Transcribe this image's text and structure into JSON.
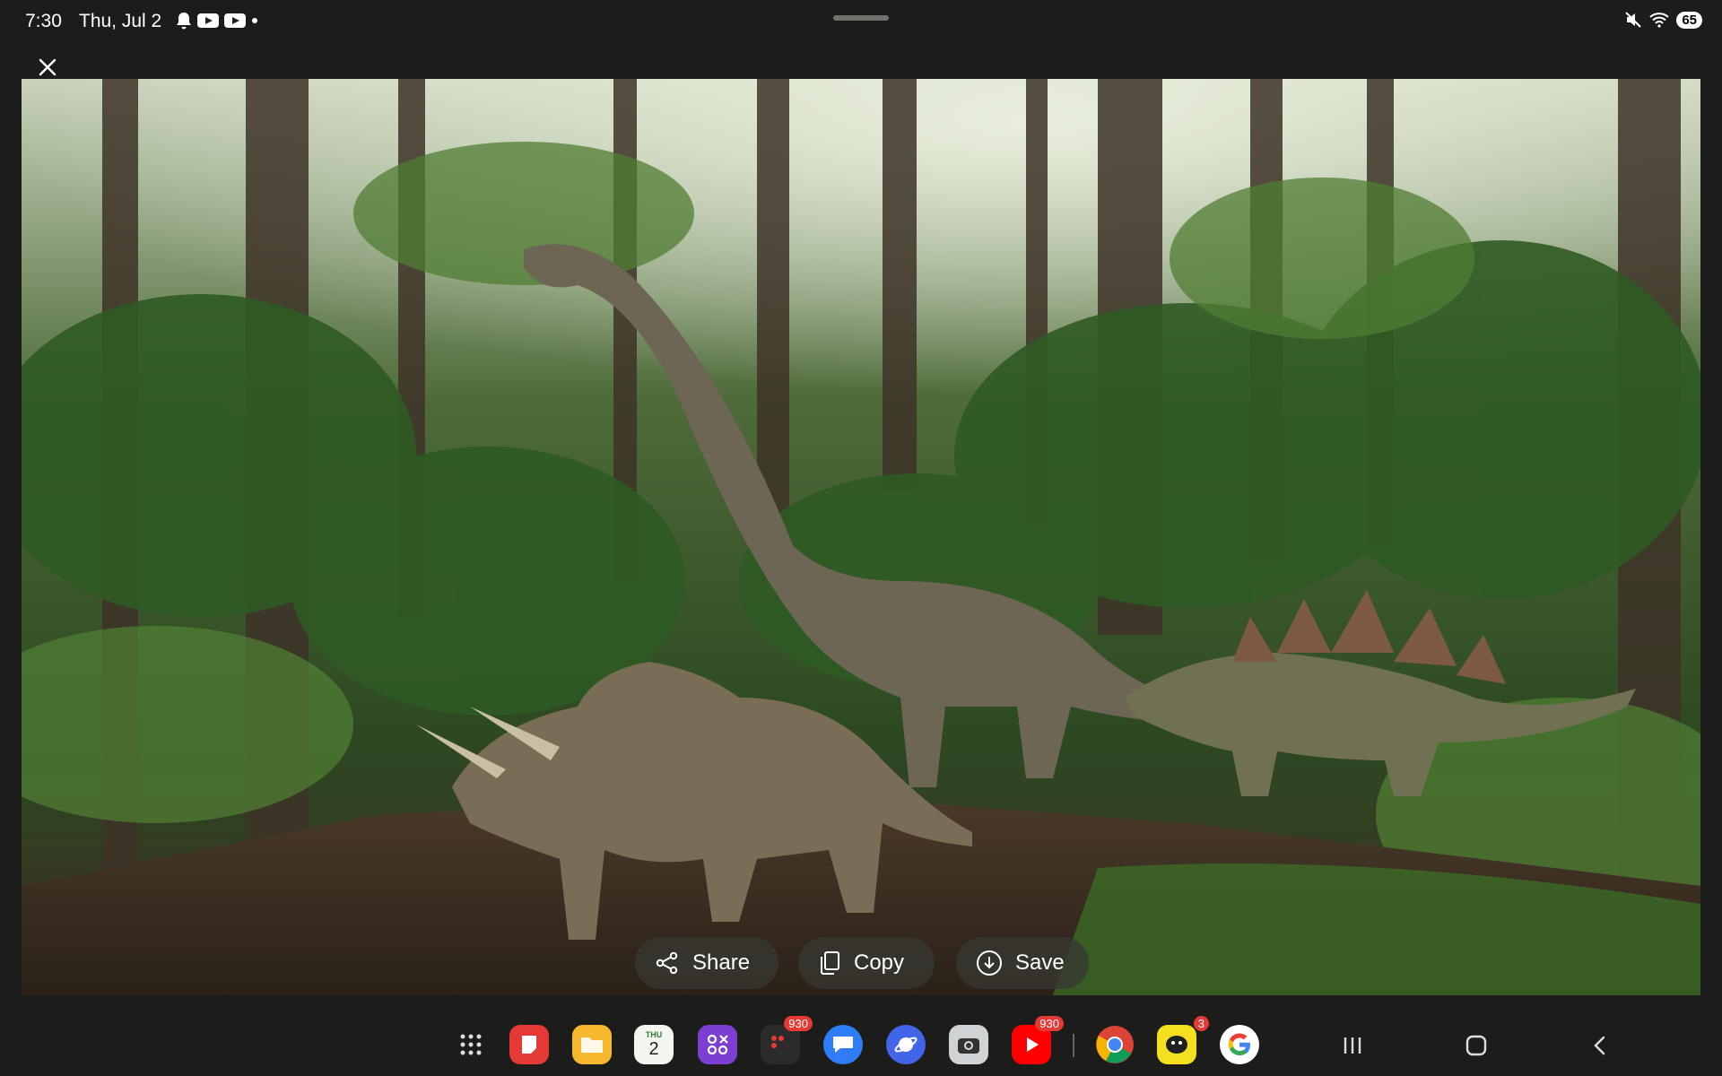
{
  "status": {
    "time": "7:30",
    "date": "Thu, Jul 2",
    "battery": "65"
  },
  "actions": {
    "share_label": "Share",
    "copy_label": "Copy",
    "save_label": "Save"
  },
  "taskbar": {
    "calendar_day_label": "THU",
    "calendar_day_number": "2",
    "badges": {
      "messages": "930",
      "youtube": "930",
      "chat": "3"
    }
  },
  "colors": {
    "background": "#1c1d1b",
    "pill": "#37372f",
    "badge": "#e53935"
  }
}
